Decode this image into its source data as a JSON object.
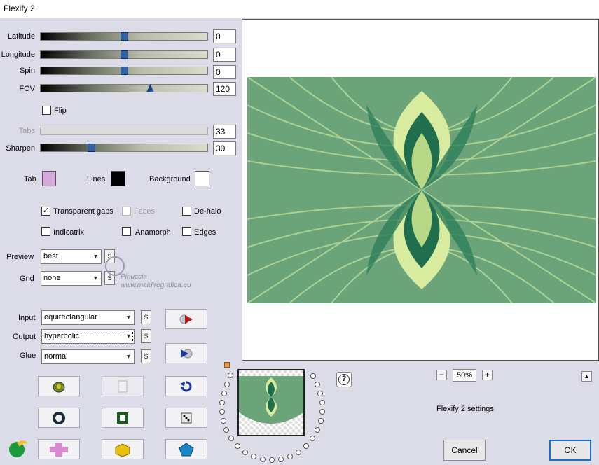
{
  "window": {
    "title": "Flexify 2"
  },
  "sliders": [
    {
      "label": "Latitude",
      "value": "0",
      "level": 0.5
    },
    {
      "label": "Longitude",
      "value": "0",
      "level": 0.5
    },
    {
      "label": "Spin",
      "value": "0",
      "level": 0.5
    },
    {
      "label": "FOV",
      "value": "120",
      "level": 0.667
    },
    {
      "label": "Tabs",
      "value": "33",
      "level": 0.0,
      "disabled": true
    },
    {
      "label": "Sharpen",
      "value": "30",
      "level": 0.3
    }
  ],
  "flip": {
    "label": "Flip",
    "checked": false
  },
  "colors": {
    "tab": {
      "label": "Tab",
      "color": "#d8a8dc"
    },
    "lines": {
      "label": "Lines",
      "color": "#000000"
    },
    "background": {
      "label": "Background",
      "color": "#ffffff"
    }
  },
  "checkboxes": {
    "transparent_gaps": {
      "label": "Transparent gaps",
      "checked": true
    },
    "faces": {
      "label": "Faces",
      "checked": false,
      "disabled": true
    },
    "de_halo": {
      "label": "De-halo",
      "checked": false
    },
    "indicatrix": {
      "label": "Indicatrix",
      "checked": false
    },
    "anamorph": {
      "label": "Anamorph",
      "checked": false
    },
    "edges": {
      "label": "Edges",
      "checked": false
    }
  },
  "dropdowns": {
    "preview": {
      "label": "Preview",
      "value": "best"
    },
    "grid": {
      "label": "Grid",
      "value": "none"
    },
    "input": {
      "label": "Input",
      "value": "equirectangular"
    },
    "output": {
      "label": "Output",
      "value": "hyperbolic"
    },
    "glue": {
      "label": "Glue",
      "value": "normal"
    }
  },
  "s_button_label": "S",
  "watermark": {
    "line1": "Pinuccia",
    "line2": "www.maidiregrafica.eu"
  },
  "zoom": {
    "minus": "−",
    "value": "50%",
    "plus": "+"
  },
  "collapse_label": "▲",
  "help_label": "?",
  "settings_label": "Flexify 2 settings",
  "buttons": {
    "cancel": "Cancel",
    "ok": "OK"
  },
  "accent_colors": {
    "fractal_dark": "#1f6e4e",
    "fractal_mid": "#6aa478",
    "fractal_light": "#d8eca0",
    "ok_border": "#1a6fd0"
  }
}
